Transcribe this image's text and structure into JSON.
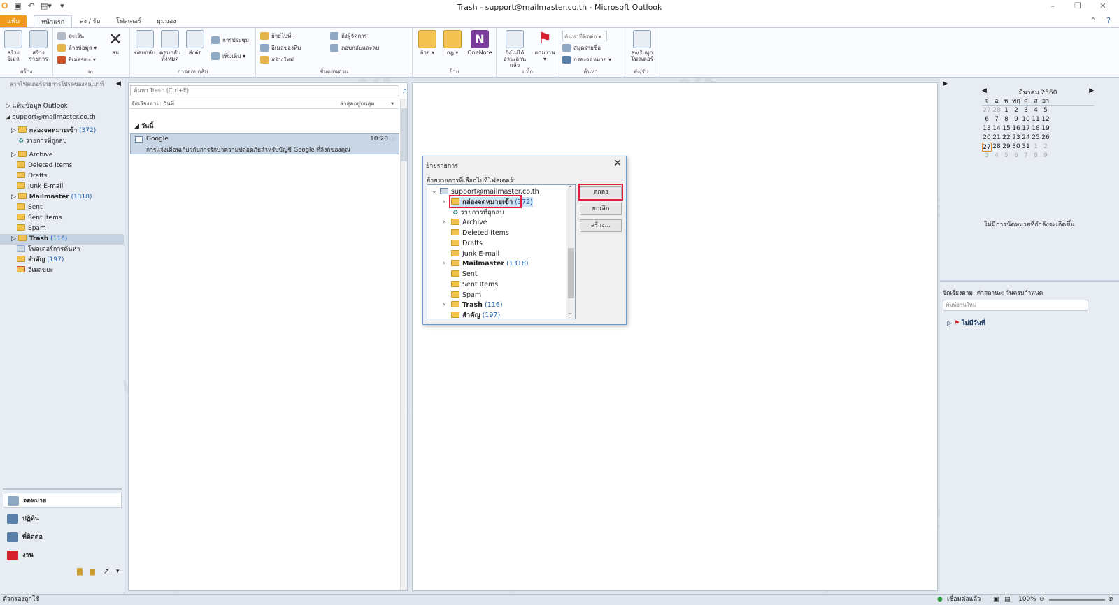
{
  "window": {
    "title": "Trash - support@mailmaster.co.th  -  Microsoft Outlook"
  },
  "ribbon_tabs": [
    "แฟ้ม",
    "หน้าแรก",
    "ส่ง / รับ",
    "โฟลเดอร์",
    "มุมมอง"
  ],
  "ribbon": {
    "new_email": "สร้างอีเมล",
    "new_items": "สร้างรายการ",
    "group_new": "สร้าง",
    "ignore": "ละเว้น",
    "cleanup": "ล้างข้อมูล",
    "junk": "อีเมลขยะ",
    "delete": "ลบ",
    "group_delete": "ลบ",
    "reply": "ตอบกลับ",
    "reply_all": "ตอบกลับทั้งหมด",
    "forward": "ส่งต่อ",
    "meeting": "การประชุม",
    "more": "เพิ่มเติม",
    "group_respond": "การตอบกลับ",
    "move_to": "ย้ายไปที่:",
    "team_email": "อีเมลของทีม",
    "create_new": "สร้างใหม่",
    "to_manager": "ถึงผู้จัดการ",
    "reply_delete": "ตอบกลับและลบ",
    "group_quicksteps": "ขั้นตอนด่วน",
    "move": "ย้าย",
    "rules": "กฎ",
    "onenote": "OneNote",
    "group_move": "ย้าย",
    "unread": "ยังไม่ได้อ่าน/อ่านแล้ว",
    "followup": "ตามงาน",
    "group_tags": "แท็ก",
    "find_contact": "ค้นหาที่ติดต่อ",
    "address_book": "สมุดรายชื่อ",
    "filter_email": "กรองจดหมาย",
    "group_find": "ค้นหา",
    "send_receive_all": "ส่ง/รับทุกโฟลเดอร์",
    "group_sendreceive": "ส่ง/รับ"
  },
  "nav": {
    "header": "ลากโฟลเดอร์รายการโปรดของคุณมาที่",
    "items": [
      {
        "label": "แฟ้มข้อมูล Outlook",
        "count": ""
      },
      {
        "label": "support@mailmaster.co.th",
        "count": ""
      },
      {
        "label": "กล่องจดหมายเข้า",
        "count": "(372)"
      },
      {
        "label": "รายการที่ถูกลบ",
        "count": ""
      },
      {
        "label": "Archive",
        "count": ""
      },
      {
        "label": "Deleted Items",
        "count": ""
      },
      {
        "label": "Drafts",
        "count": ""
      },
      {
        "label": "Junk E-mail",
        "count": ""
      },
      {
        "label": "Mailmaster",
        "count": "(1318)"
      },
      {
        "label": "Sent",
        "count": ""
      },
      {
        "label": "Sent Items",
        "count": ""
      },
      {
        "label": "Spam",
        "count": ""
      },
      {
        "label": "Trash",
        "count": "(116)"
      },
      {
        "label": "โฟลเดอร์การค้นหา",
        "count": ""
      },
      {
        "label": "สำคัญ",
        "count": "(197)"
      },
      {
        "label": "อีเมลขยะ",
        "count": ""
      }
    ],
    "buttons": [
      "จดหมาย",
      "ปฏิทิน",
      "ที่ติดต่อ",
      "งาน"
    ]
  },
  "list": {
    "search_placeholder": "ค้นหา Trash (Ctrl+E)",
    "arrange": "จัดเรียงตาม: วันที่",
    "order": "ล่าสุดอยู่บนสุด",
    "group": "วันนี้",
    "message": {
      "from": "Google",
      "time": "10:20",
      "subject": "การแจ้งเตือนเกี่ยวกับการรักษาความปลอดภัยสำหรับบัญชี Google ที่ลิงก์ของคุณ"
    }
  },
  "todo": {
    "month": "มีนาคม 2560",
    "weekdays": [
      "จ",
      "อ",
      "พ",
      "พฤ",
      "ศ",
      "ส",
      "อา"
    ],
    "weeks": [
      [
        "27",
        "28",
        "1",
        "2",
        "3",
        "4",
        "5"
      ],
      [
        "6",
        "7",
        "8",
        "9",
        "10",
        "11",
        "12"
      ],
      [
        "13",
        "14",
        "15",
        "16",
        "17",
        "18",
        "19"
      ],
      [
        "20",
        "21",
        "22",
        "23",
        "24",
        "25",
        "26"
      ],
      [
        "27",
        "28",
        "29",
        "30",
        "31",
        "1",
        "2"
      ],
      [
        "3",
        "4",
        "5",
        "6",
        "7",
        "8",
        "9"
      ]
    ],
    "no_appointments": "ไม่มีการนัดหมายที่กำลังจะเกิดขึ้น",
    "task_arrange": "จัดเรียงตาม: ค่าสถานะ: วันครบกำหนด",
    "task_placeholder": "พิมพ์งานใหม่",
    "no_date": "ไม่มีวันที่"
  },
  "dialog": {
    "title": "ย้ายรายการ",
    "label": "ย้ายรายการที่เลือกไปที่โฟลเดอร์:",
    "tree": [
      {
        "label": "support@mailmaster.co.th",
        "count": ""
      },
      {
        "label": "กล่องจดหมายเข้า",
        "count": "(372)"
      },
      {
        "label": "รายการที่ถูกลบ",
        "count": ""
      },
      {
        "label": "Archive",
        "count": ""
      },
      {
        "label": "Deleted Items",
        "count": ""
      },
      {
        "label": "Drafts",
        "count": ""
      },
      {
        "label": "Junk E-mail",
        "count": ""
      },
      {
        "label": "Mailmaster",
        "count": "(1318)"
      },
      {
        "label": "Sent",
        "count": ""
      },
      {
        "label": "Sent Items",
        "count": ""
      },
      {
        "label": "Spam",
        "count": ""
      },
      {
        "label": "Trash",
        "count": "(116)"
      },
      {
        "label": "สำคัญ",
        "count": "(197)"
      }
    ],
    "ok": "ตกลง",
    "cancel": "ยกเลิก",
    "new": "สร้าง..."
  },
  "status": {
    "filter": "ตัวกรองถูกใช้",
    "connected": "เชื่อมต่อแล้ว",
    "zoom": "100%"
  },
  "colors": {
    "file_tab": "#f29a1b",
    "highlight": "#e0203a",
    "selection": "#c9d6e6",
    "count": "#1f5fb4"
  }
}
